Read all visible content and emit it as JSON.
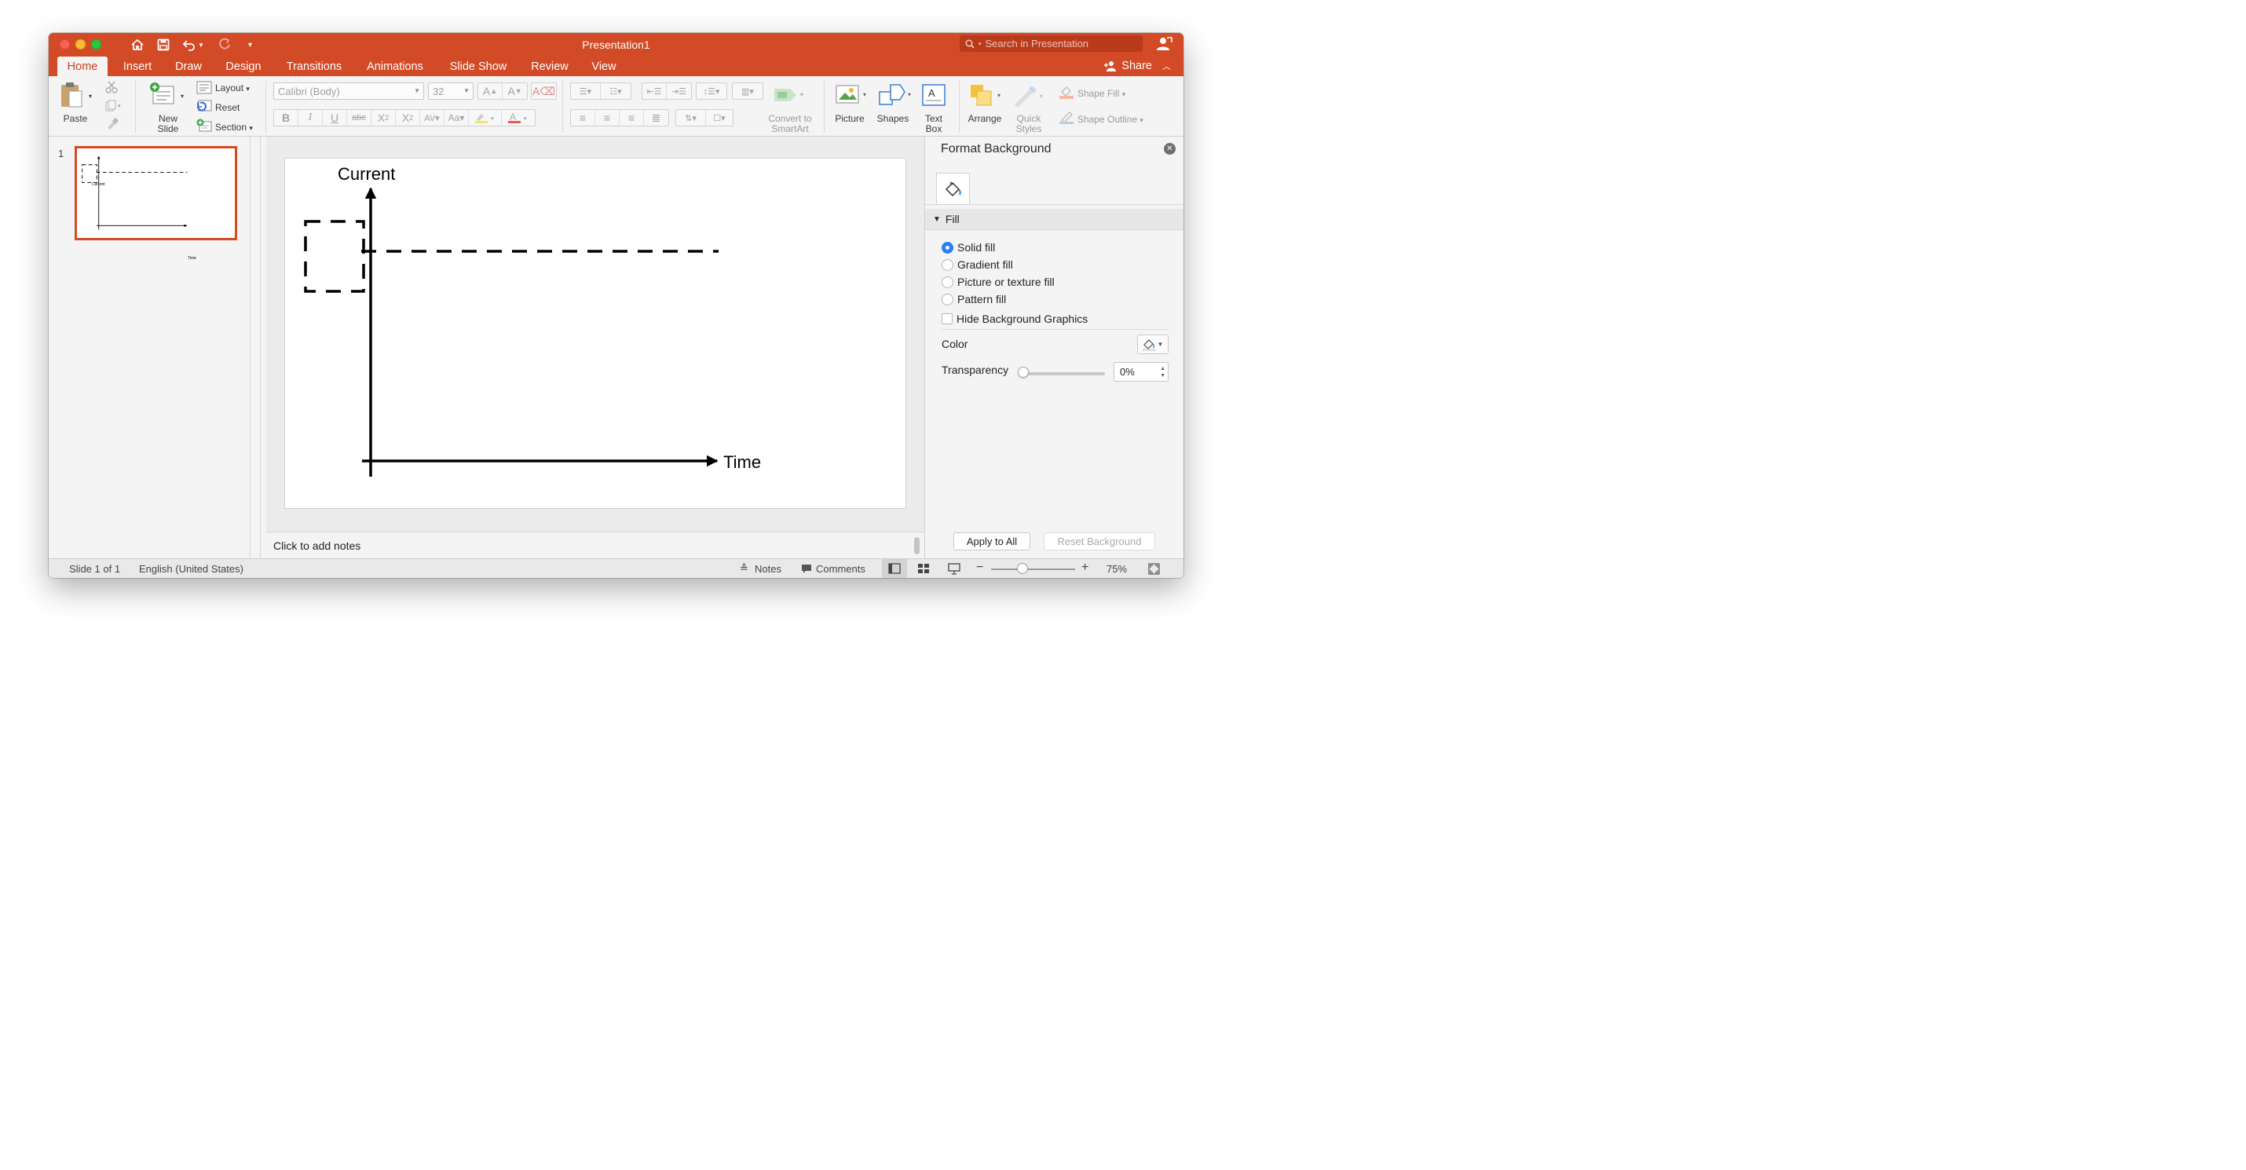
{
  "window": {
    "title": "Presentation1",
    "search_placeholder": "Search in Presentation",
    "share_label": "Share"
  },
  "tabs": [
    {
      "label": "Home",
      "active": true
    },
    {
      "label": "Insert"
    },
    {
      "label": "Draw"
    },
    {
      "label": "Design"
    },
    {
      "label": "Transitions"
    },
    {
      "label": "Animations"
    },
    {
      "label": "Slide Show"
    },
    {
      "label": "Review"
    },
    {
      "label": "View"
    }
  ],
  "ribbon": {
    "paste": "Paste",
    "new_slide_1": "New",
    "new_slide_2": "Slide",
    "layout": "Layout",
    "reset": "Reset",
    "section": "Section",
    "font_name": "Calibri (Body)",
    "font_size": "32",
    "convert_1": "Convert to",
    "convert_2": "SmartArt",
    "picture": "Picture",
    "shapes": "Shapes",
    "textbox_1": "Text",
    "textbox_2": "Box",
    "arrange": "Arrange",
    "quick_styles_1": "Quick",
    "quick_styles_2": "Styles",
    "shape_fill": "Shape Fill",
    "shape_outline": "Shape Outline"
  },
  "thumbnails": {
    "number": "1"
  },
  "slide": {
    "y_axis_label": "Current",
    "x_axis_label": "Time"
  },
  "notes": {
    "placeholder": "Click to add notes"
  },
  "format_pane": {
    "title": "Format Background",
    "section": "Fill",
    "options": [
      {
        "label": "Solid fill",
        "selected": true
      },
      {
        "label": "Gradient fill",
        "selected": false
      },
      {
        "label": "Picture or texture fill",
        "selected": false
      },
      {
        "label": "Pattern fill",
        "selected": false
      }
    ],
    "hide_graphics": "Hide Background Graphics",
    "color_label": "Color",
    "transparency_label": "Transparency",
    "transparency_value": "0%",
    "transparency_level": 0,
    "apply_all": "Apply to All",
    "reset_bg": "Reset Background"
  },
  "status": {
    "slide_info": "Slide 1 of 1",
    "language": "English (United States)",
    "notes": "Notes",
    "comments": "Comments",
    "zoom": "75%"
  },
  "colors": {
    "accent": "#d24a26",
    "selection_blue": "#2f7ff2"
  }
}
